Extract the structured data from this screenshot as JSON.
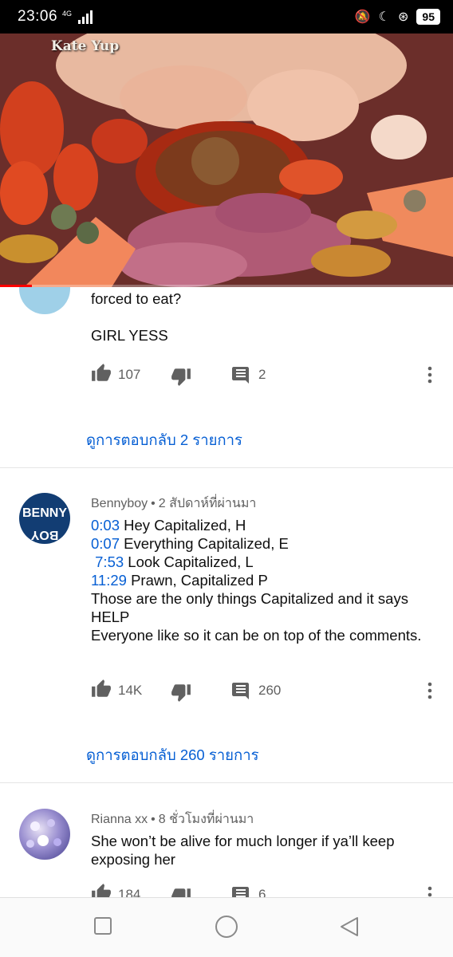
{
  "status_bar": {
    "time": "23:06",
    "network": "4G",
    "battery": "95"
  },
  "video": {
    "watermark": "Kate Yup",
    "progress_fraction": 0.07
  },
  "comments": [
    {
      "text_lines": [
        "forced to eat?",
        "",
        "GIRL YESS"
      ],
      "likes": "107",
      "replies": "2",
      "view_replies": "ดูการตอบกลับ 2 รายการ"
    },
    {
      "author": "Bennyboy",
      "time_ago": "2 สัปดาห์ที่ผ่านมา",
      "avatar_text": [
        "BENNY",
        "BOY"
      ],
      "timestamp_lines": [
        {
          "ts": "0:03",
          "text": " Hey Capitalized, H"
        },
        {
          "ts": "0:07",
          "text": " Everything Capitalized, E"
        },
        {
          "ts": " 7:53",
          "text": " Look Capitalized, L"
        },
        {
          "ts": "11:29",
          "text": " Prawn, Capitalized P"
        }
      ],
      "text_rest": "Those are the only things Capitalized and it says HELP\nEveryone like so it can be on top of the comments.",
      "likes": "14K",
      "replies": "260",
      "view_replies": "ดูการตอบกลับ 260 รายการ"
    },
    {
      "author": "Rianna xx",
      "time_ago": "8 ชั่วโมงที่ผ่านมา",
      "text": "She won’t be alive for much longer if ya’ll keep exposing her",
      "likes": "184",
      "replies": "6"
    }
  ],
  "icons": {
    "like": "thumb-up-icon",
    "dislike": "thumb-down-icon",
    "reply": "comment-icon",
    "more": "more-vert-icon",
    "nav_recents": "square-icon",
    "nav_home": "circle-icon",
    "nav_back": "triangle-back-icon"
  },
  "colors": {
    "link": "#065fd4",
    "progress": "#ff0000",
    "avatar_benny": "#123d73"
  }
}
